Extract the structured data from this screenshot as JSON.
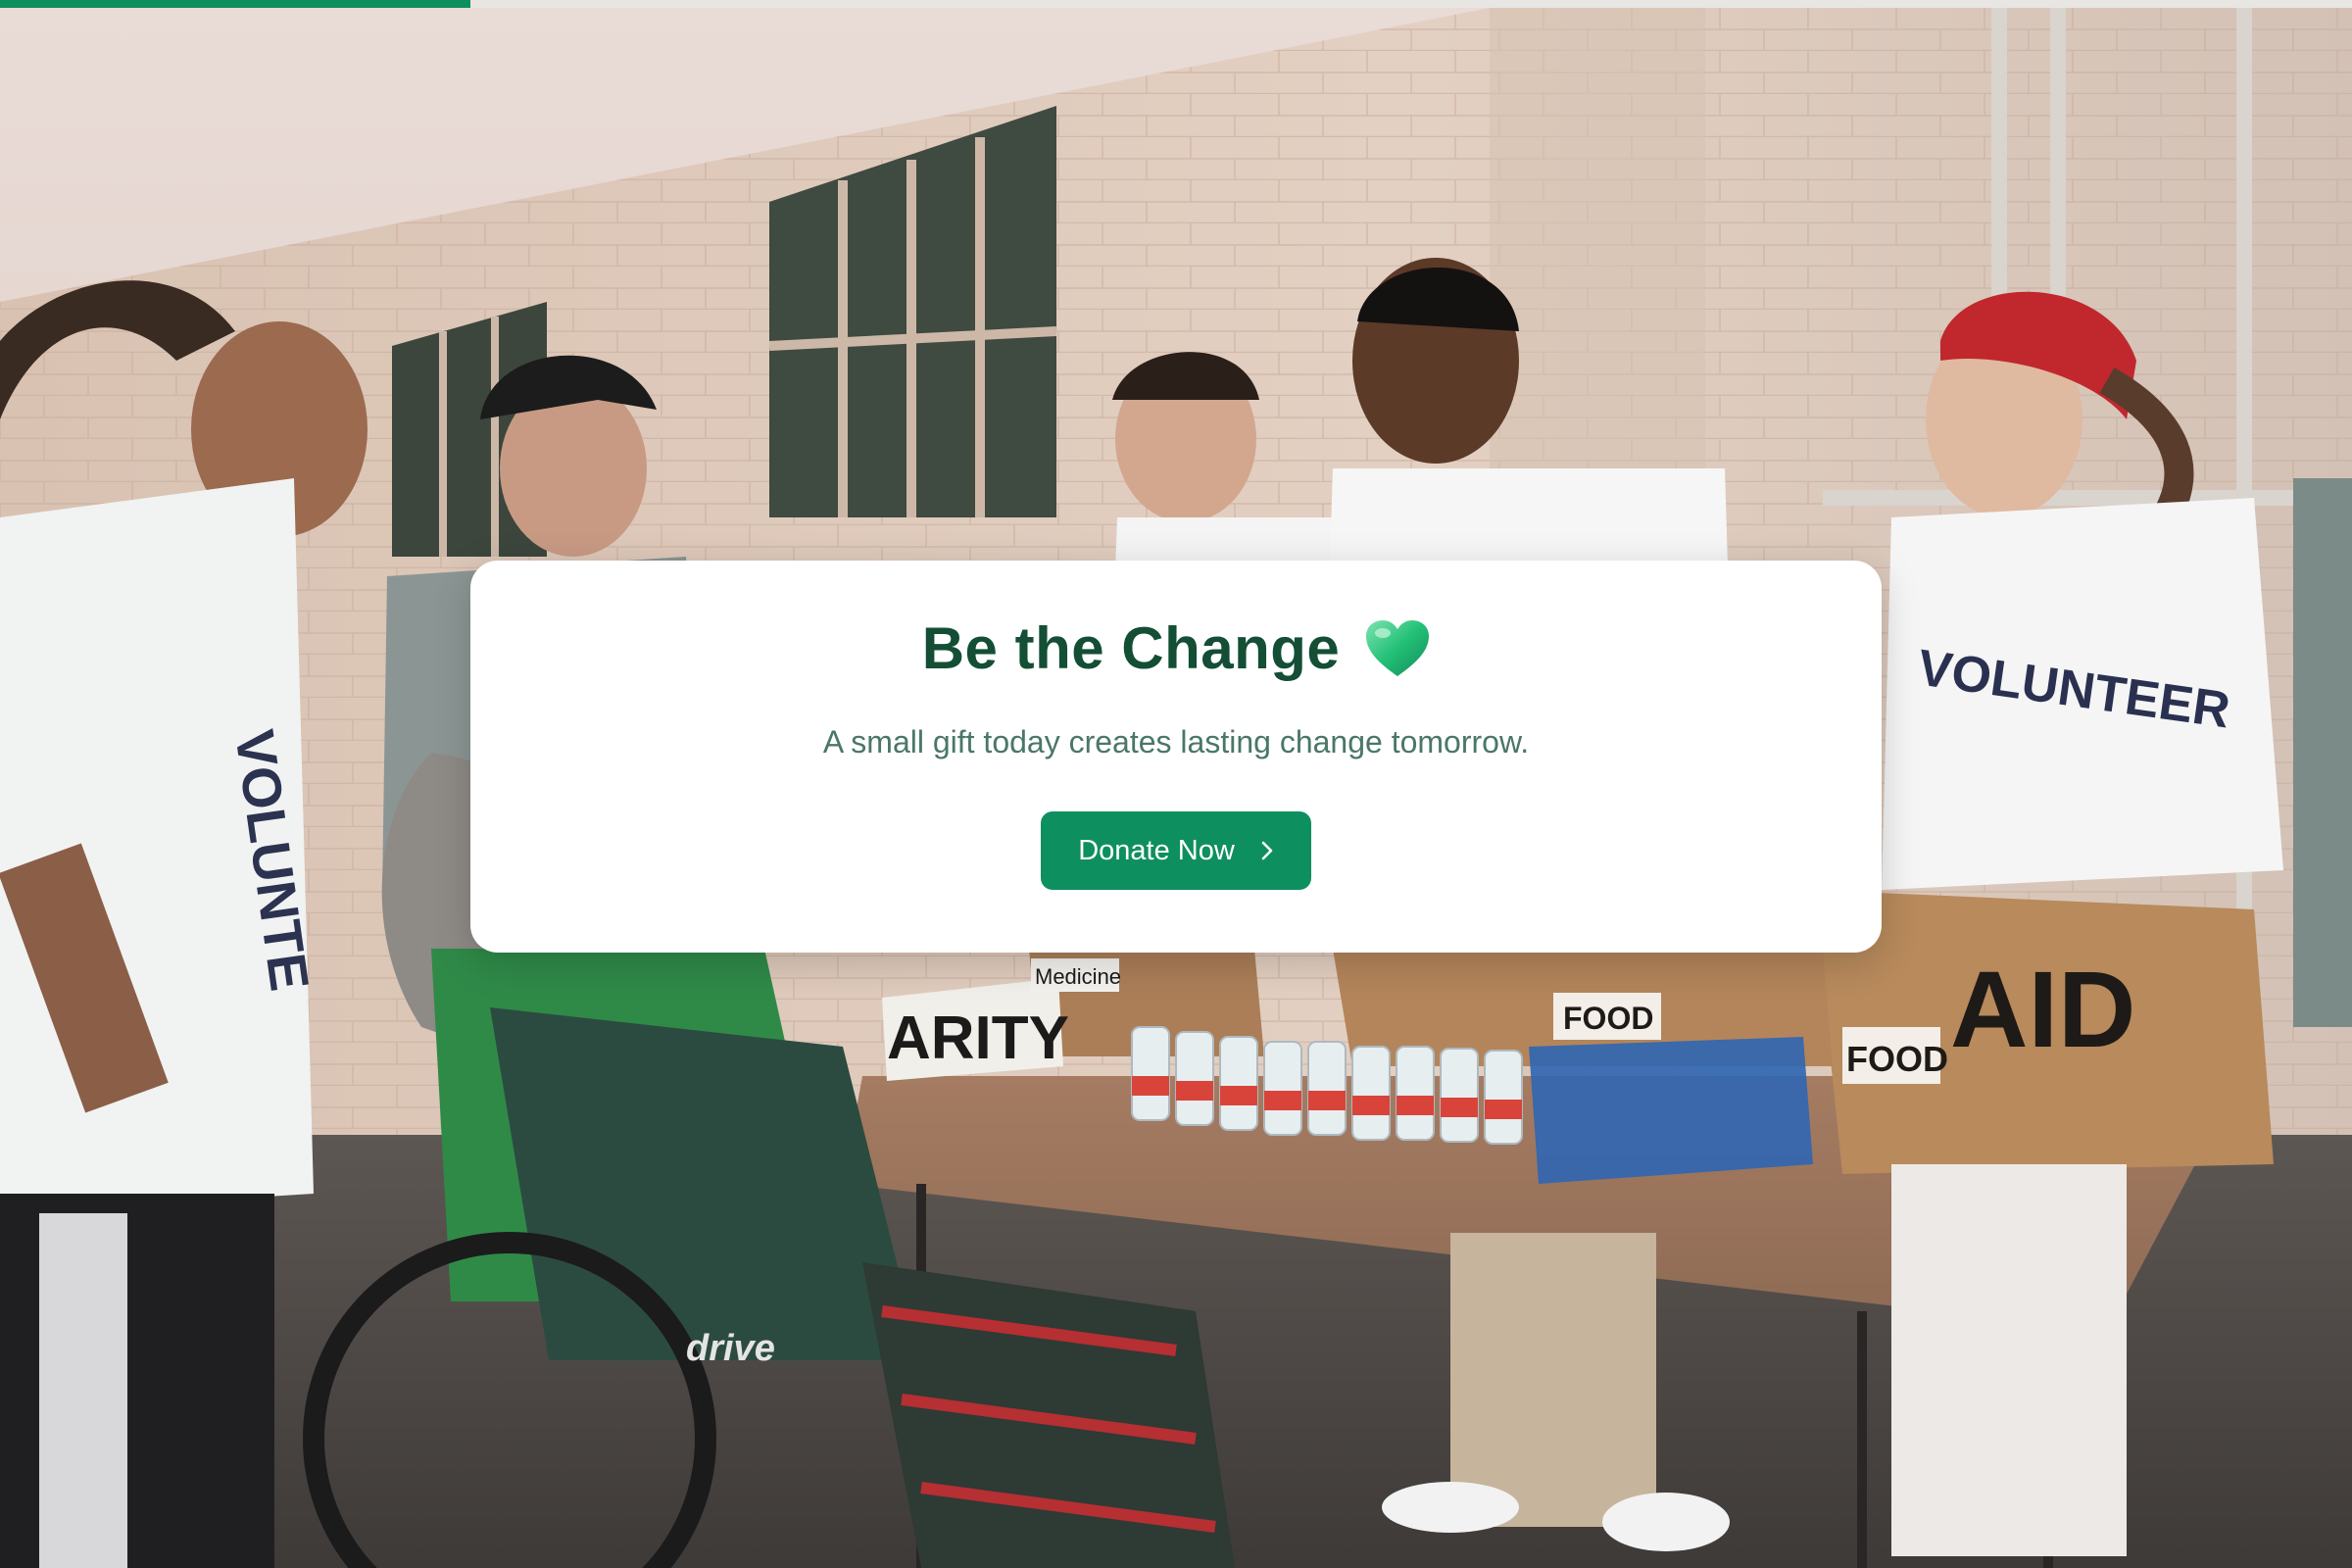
{
  "progress": {
    "value_percent": 20,
    "track_color": "#e8e6e3",
    "fill_color": "#0d8f5e"
  },
  "background_photo": {
    "signs": {
      "volunteer_shirt_right": "VOLUNTEER",
      "volunteer_shirt_left": "VOLUNTE",
      "box_aid": "AID",
      "box_food_right": "FOOD",
      "box_food_center": "FOOD",
      "charity_sign": "ARITY",
      "medicine_sign": "Medicine",
      "wheelchair_brand": "drive"
    }
  },
  "hero": {
    "title": "Be the Change",
    "title_icon": "green-heart-icon",
    "subtitle": "A small gift today creates lasting change tomorrow.",
    "donate_label": "Donate Now",
    "donate_icon": "chevron-right-icon",
    "colors": {
      "title": "#134e35",
      "subtitle": "#4a7766",
      "button": "#0e8f5f",
      "button_text": "#ffffff"
    }
  }
}
